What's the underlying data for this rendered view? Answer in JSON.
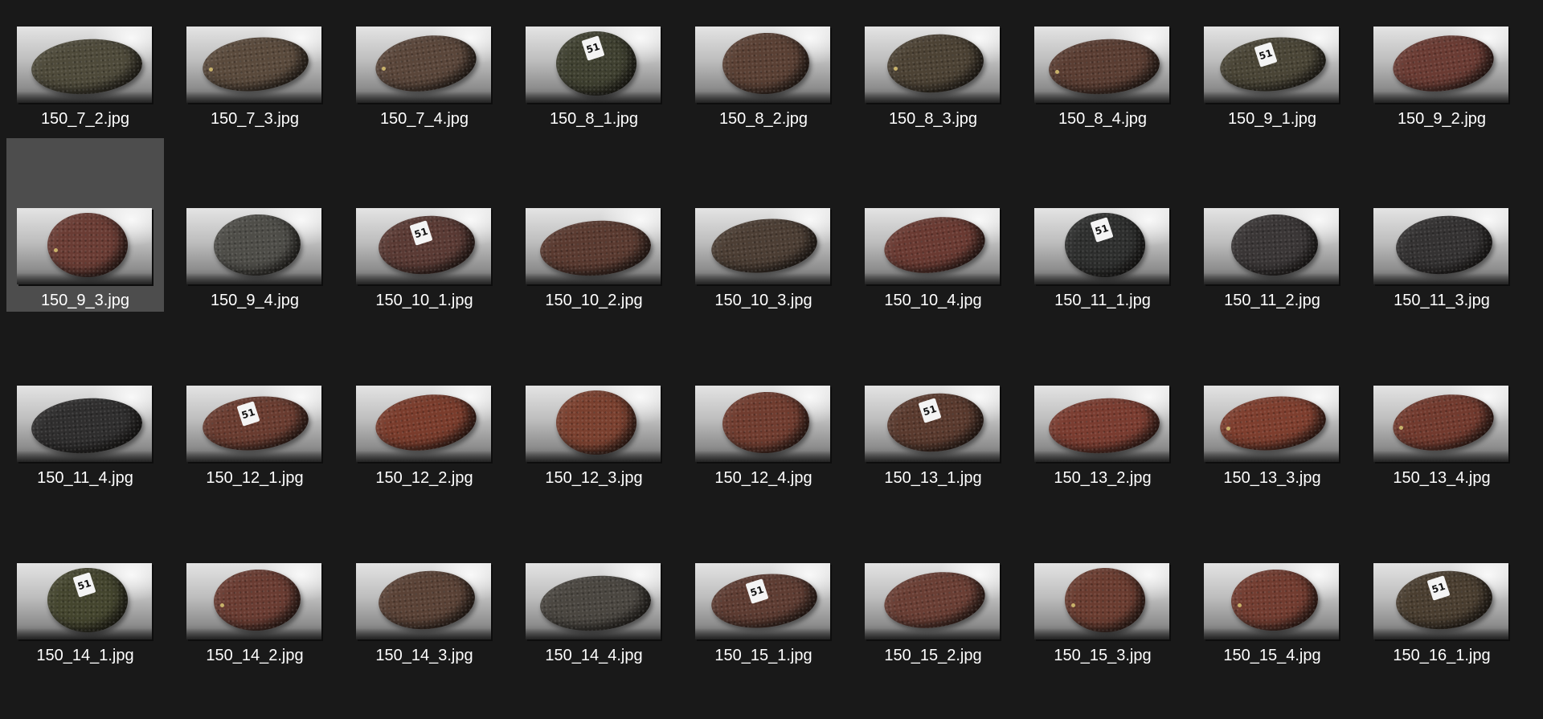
{
  "window": {
    "background": "#191919",
    "selection_color": "#4d4d4d"
  },
  "files": [
    {
      "name": "150_7_2.jpg",
      "fruit": "#4e4a3a",
      "sticker": "",
      "stem": false
    },
    {
      "name": "150_7_3.jpg",
      "fruit": "#5a4a3c",
      "sticker": "",
      "stem": true
    },
    {
      "name": "150_7_4.jpg",
      "fruit": "#5a463a",
      "sticker": "",
      "stem": true
    },
    {
      "name": "150_8_1.jpg",
      "fruit": "#3f4030",
      "sticker": "51",
      "stem": false
    },
    {
      "name": "150_8_2.jpg",
      "fruit": "#5a4034",
      "sticker": "",
      "stem": false
    },
    {
      "name": "150_8_3.jpg",
      "fruit": "#4c4234",
      "sticker": "",
      "stem": true
    },
    {
      "name": "150_8_4.jpg",
      "fruit": "#5a3d32",
      "sticker": "",
      "stem": true
    },
    {
      "name": "150_9_1.jpg",
      "fruit": "#4a4536",
      "sticker": "51",
      "stem": false
    },
    {
      "name": "150_9_2.jpg",
      "fruit": "#6a3b33",
      "sticker": "",
      "stem": false
    },
    {
      "name": "150_9_3.jpg",
      "fruit": "#6a3c34",
      "sticker": "",
      "stem": true,
      "selected": true
    },
    {
      "name": "150_9_4.jpg",
      "fruit": "#4e4d48",
      "sticker": "",
      "stem": false
    },
    {
      "name": "150_10_1.jpg",
      "fruit": "#5a3a34",
      "sticker": "51",
      "stem": false
    },
    {
      "name": "150_10_2.jpg",
      "fruit": "#5a3a30",
      "sticker": "",
      "stem": false
    },
    {
      "name": "150_10_3.jpg",
      "fruit": "#4c3e34",
      "sticker": "",
      "stem": false
    },
    {
      "name": "150_10_4.jpg",
      "fruit": "#6a3a32",
      "sticker": "",
      "stem": false
    },
    {
      "name": "150_11_1.jpg",
      "fruit": "#2e2f2e",
      "sticker": "51",
      "stem": false
    },
    {
      "name": "150_11_2.jpg",
      "fruit": "#3a3636",
      "sticker": "",
      "stem": false
    },
    {
      "name": "150_11_3.jpg",
      "fruit": "#343232",
      "sticker": "",
      "stem": false
    },
    {
      "name": "150_11_4.jpg",
      "fruit": "#2f2e2e",
      "sticker": "",
      "stem": false
    },
    {
      "name": "150_12_1.jpg",
      "fruit": "#6a3c30",
      "sticker": "51",
      "stem": false
    },
    {
      "name": "150_12_2.jpg",
      "fruit": "#7a3c2c",
      "sticker": "",
      "stem": false
    },
    {
      "name": "150_12_3.jpg",
      "fruit": "#7a402f",
      "sticker": "",
      "stem": false
    },
    {
      "name": "150_12_4.jpg",
      "fruit": "#703c2f",
      "sticker": "",
      "stem": false
    },
    {
      "name": "150_13_1.jpg",
      "fruit": "#5a3a2e",
      "sticker": "51",
      "stem": false
    },
    {
      "name": "150_13_2.jpg",
      "fruit": "#7a3c30",
      "sticker": "",
      "stem": false
    },
    {
      "name": "150_13_3.jpg",
      "fruit": "#7e3e2e",
      "sticker": "",
      "stem": true
    },
    {
      "name": "150_13_4.jpg",
      "fruit": "#723a2e",
      "sticker": "",
      "stem": true
    },
    {
      "name": "150_14_1.jpg",
      "fruit": "#44452e",
      "sticker": "51",
      "stem": false
    },
    {
      "name": "150_14_2.jpg",
      "fruit": "#6a3c32",
      "sticker": "",
      "stem": true
    },
    {
      "name": "150_14_3.jpg",
      "fruit": "#5a4236",
      "sticker": "",
      "stem": false
    },
    {
      "name": "150_14_4.jpg",
      "fruit": "#4a4640",
      "sticker": "",
      "stem": false
    },
    {
      "name": "150_15_1.jpg",
      "fruit": "#5e3c32",
      "sticker": "51",
      "stem": false
    },
    {
      "name": "150_15_2.jpg",
      "fruit": "#6a3e34",
      "sticker": "",
      "stem": false
    },
    {
      "name": "150_15_3.jpg",
      "fruit": "#6a3c30",
      "sticker": "",
      "stem": true
    },
    {
      "name": "150_15_4.jpg",
      "fruit": "#723c30",
      "sticker": "",
      "stem": true
    },
    {
      "name": "150_16_1.jpg",
      "fruit": "#4a3e30",
      "sticker": "51",
      "stem": false
    }
  ]
}
